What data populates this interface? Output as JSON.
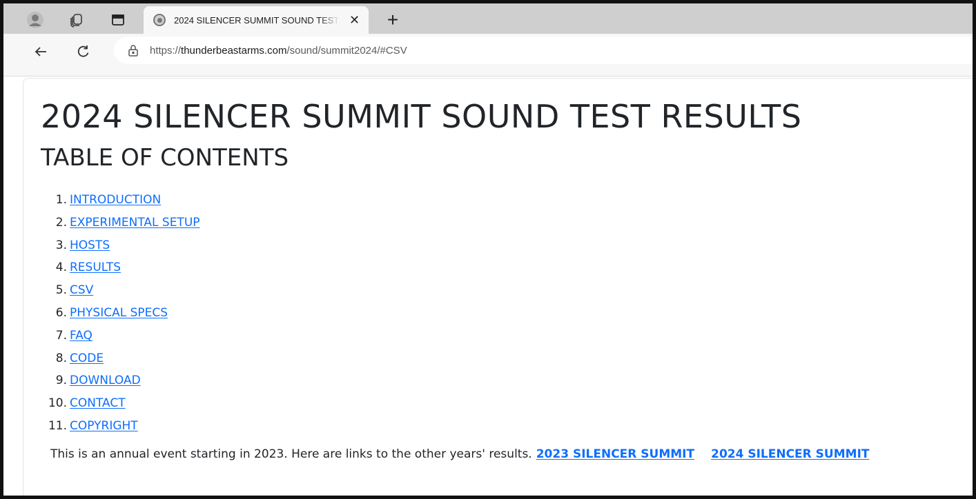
{
  "browser": {
    "tab": {
      "title": "2024 SILENCER SUMMIT SOUND TEST RESULTS",
      "close_glyph": "✕"
    },
    "new_tab_glyph": "+",
    "address": {
      "scheme": "https://",
      "host": "thunderbeastarms.com",
      "path": "/sound/summit2024/#CSV"
    },
    "icons": [
      "profile-icon",
      "workspaces-icon",
      "tab-actions-icon",
      "favicon",
      "back-arrow-icon",
      "refresh-icon",
      "lock-icon"
    ]
  },
  "page": {
    "title": "2024 SILENCER SUMMIT SOUND TEST RESULTS",
    "toc_heading": "TABLE OF CONTENTS",
    "toc": [
      {
        "num": "1.",
        "label": "INTRODUCTION"
      },
      {
        "num": "2.",
        "label": "EXPERIMENTAL SETUP"
      },
      {
        "num": "3.",
        "label": "HOSTS"
      },
      {
        "num": "4.",
        "label": "RESULTS"
      },
      {
        "num": "5.",
        "label": "CSV"
      },
      {
        "num": "6.",
        "label": "PHYSICAL SPECS"
      },
      {
        "num": "7.",
        "label": "FAQ"
      },
      {
        "num": "8.",
        "label": "CODE"
      },
      {
        "num": "9.",
        "label": "DOWNLOAD"
      },
      {
        "num": "10.",
        "label": "CONTACT"
      },
      {
        "num": "11.",
        "label": "COPYRIGHT"
      }
    ],
    "footer_text": "This is an annual event starting in 2023. Here are links to the other years' results.",
    "footer_links": [
      "2023 SILENCER SUMMIT",
      "2024 SILENCER SUMMIT"
    ]
  },
  "colors": {
    "link": "#0d6efd",
    "text": "#212529",
    "tabstrip": "#cfcfcf",
    "toolbar": "#f7f7f7"
  }
}
